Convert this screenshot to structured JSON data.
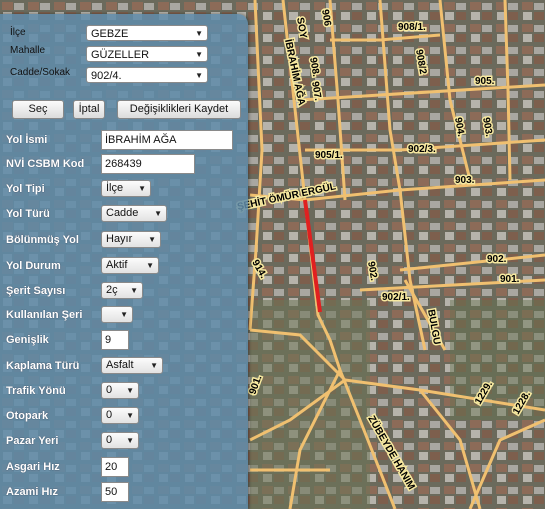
{
  "filters": {
    "ilce": {
      "label": "İlçe",
      "value": "GEBZE"
    },
    "mahalle": {
      "label": "Mahalle",
      "value": "GÜZELLER"
    },
    "cadde": {
      "label": "Cadde/Sokak",
      "value": "902/4."
    }
  },
  "buttons": {
    "sec": "Seç",
    "iptal": "İptal",
    "kaydet": "Değişiklikleri Kaydet"
  },
  "fields": {
    "yol_ismi": {
      "label": "Yol İsmi",
      "value": "İBRAHİM AĞA"
    },
    "nvi_kod": {
      "label": "NVİ CSBM Kod",
      "value": "268439"
    },
    "yol_tipi": {
      "label": "Yol Tipi",
      "value": "İlçe"
    },
    "yol_turu": {
      "label": "Yol Türü",
      "value": "Cadde"
    },
    "bolunmus": {
      "label": "Bölünmüş Yol",
      "value": "Hayır"
    },
    "yol_durum": {
      "label": "Yol Durum",
      "value": "Aktif"
    },
    "serit": {
      "label": "Şerit Sayısı",
      "value": "2ç"
    },
    "kullanilan": {
      "label": "Kullanılan Şeri",
      "value": ""
    },
    "genislik": {
      "label": "Genişlik",
      "value": "9"
    },
    "kaplama": {
      "label": "Kaplama Türü",
      "value": "Asfalt"
    },
    "trafik": {
      "label": "Trafik Yönü",
      "value": "0"
    },
    "otopark": {
      "label": "Otopark",
      "value": "0"
    },
    "pazar": {
      "label": "Pazar Yeri",
      "value": "0"
    },
    "asgari": {
      "label": "Asgari Hız",
      "value": "20"
    },
    "azami": {
      "label": "Azami Hız",
      "value": "50"
    }
  },
  "map_labels": {
    "ibrahim_aga": "İBRAHİM AĞA",
    "soy": "SOY",
    "s908": "908.",
    "s907": "907.",
    "s908_1": "908/1.",
    "s908_2": "908/2",
    "s906": "906",
    "s905": "905.",
    "s903": "903.",
    "s904": "904.",
    "s905_1": "905/1.",
    "s902_3": "902/3.",
    "s903b": "903.",
    "umur": "ŞEHİT ÖMÜR ERGÜL",
    "s902": "902.",
    "s901": "901.",
    "s902b": "902.",
    "s902_1": "902/1.",
    "bulgu": "BULGU",
    "s914": "914.",
    "zubeyde": "ZÜBEYDE HANIM",
    "s1229": "1229.",
    "s1228": "1228.",
    "s901b": "901."
  },
  "colors": {
    "selected_road": "#e02020",
    "road": "#f0c070",
    "panel": "#5f8caa"
  }
}
